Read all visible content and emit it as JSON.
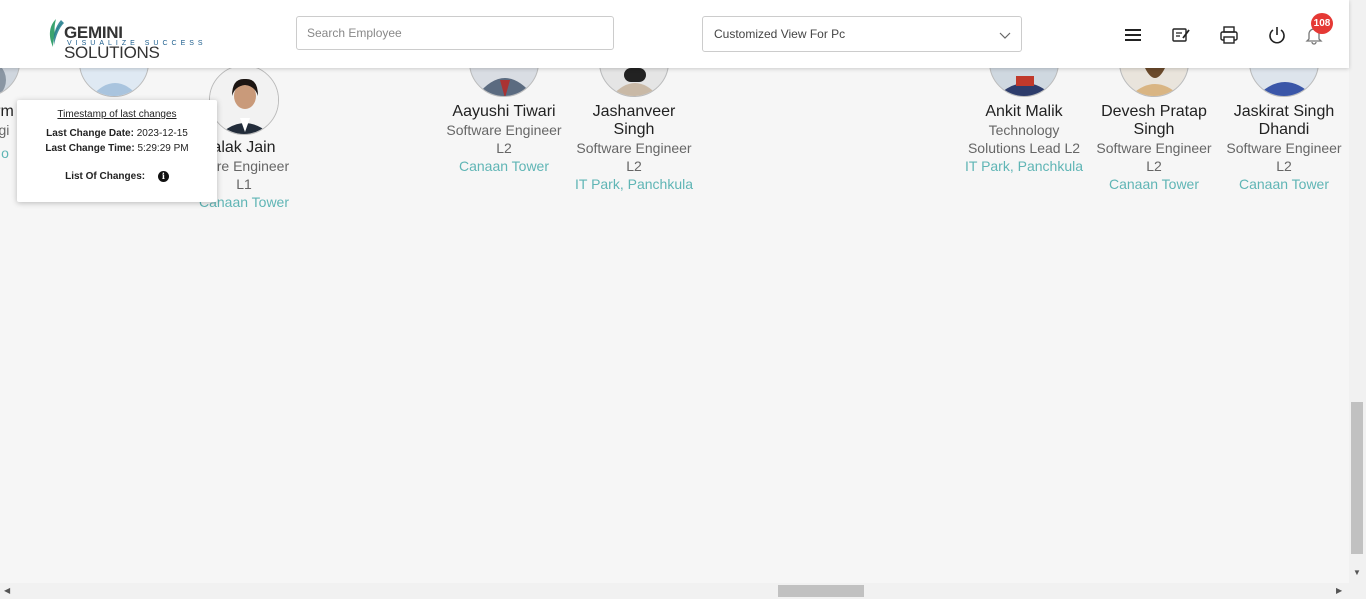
{
  "brand": {
    "name_bold": "GEMINI",
    "name_rest": " SOLUTIONS",
    "tagline": "VISUALIZE SUCCESS"
  },
  "search": {
    "placeholder": "Search Employee"
  },
  "view_select": {
    "value": "Customized View For Pc"
  },
  "header_icons": [
    "menu-icon",
    "edit-note-icon",
    "print-icon",
    "power-icon",
    "bell-icon"
  ],
  "notifications": {
    "count": "108"
  },
  "tooltip": {
    "title": "Timestamp of last changes",
    "date_label": "Last Change Date:",
    "date_value": "2023-12-15",
    "time_label": "Last Change Time:",
    "time_value": "5:29:29 PM",
    "changes_label": "List Of Changes:"
  },
  "employees": [
    {
      "name": "arm",
      "role": "ngi",
      "location": "No"
    },
    {
      "name": "alak Jain",
      "role_lines": [
        "ware Engineer",
        "L1"
      ],
      "location": "Canaan Tower"
    },
    {
      "name": "Aayushi Tiwari",
      "role_lines": [
        "Software Engineer",
        "L2"
      ],
      "location": "Canaan Tower"
    },
    {
      "name_lines": [
        "Jashanveer",
        "Singh"
      ],
      "role_lines": [
        "Software Engineer",
        "L2"
      ],
      "location": "IT Park, Panchkula"
    },
    {
      "name": "Ankit Malik",
      "role_lines": [
        "Technology",
        "Solutions Lead L2"
      ],
      "location": "IT Park, Panchkula"
    },
    {
      "name_lines": [
        "Devesh Pratap",
        "Singh"
      ],
      "role_lines": [
        "Software Engineer",
        "L2"
      ],
      "location": "Canaan Tower"
    },
    {
      "name_lines": [
        "Jaskirat Singh",
        "Dhandi"
      ],
      "role_lines": [
        "Software Engineer",
        "L2"
      ],
      "location": "Canaan Tower"
    }
  ],
  "colors": {
    "accent": "#5fb5b5",
    "badge": "#e53935",
    "background": "#f6f6f6"
  }
}
